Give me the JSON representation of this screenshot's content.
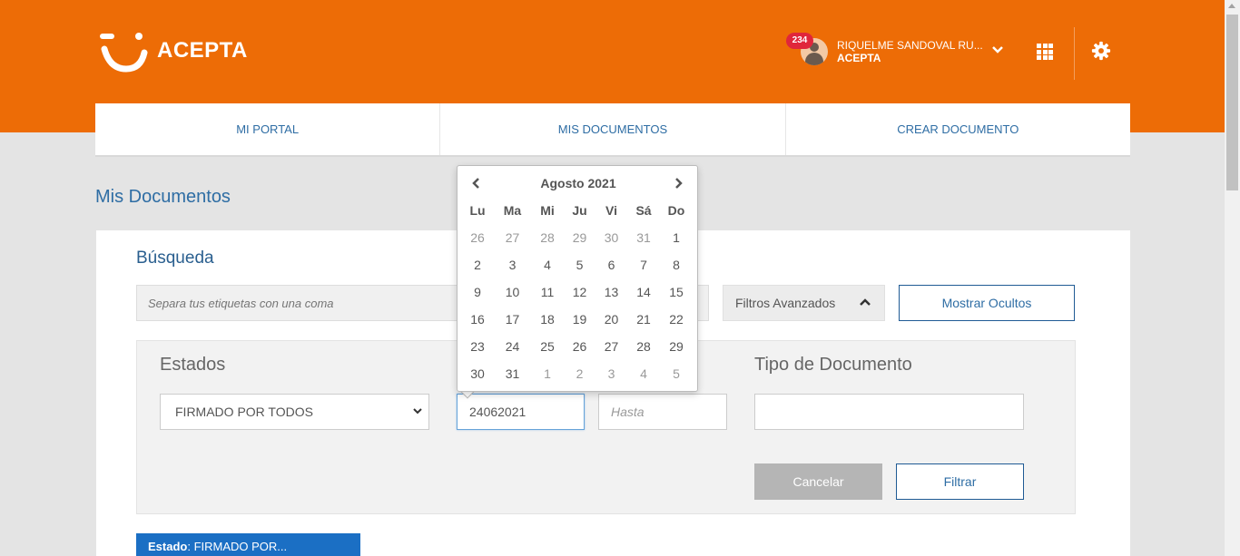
{
  "brand": {
    "name": "ACEPTA",
    "color": "#ed6c06"
  },
  "user": {
    "notifications": "234",
    "name": "RIQUELME SANDOVAL RU...",
    "org": "ACEPTA"
  },
  "nav": {
    "tabs": [
      "MI PORTAL",
      "MIS DOCUMENTOS",
      "CREAR DOCUMENTO"
    ]
  },
  "page": {
    "title": "Mis Documentos"
  },
  "search": {
    "title": "Búsqueda",
    "tags_placeholder": "Separa tus etiquetas con una coma",
    "advanced_filters": "Filtros Avanzados",
    "show_hidden": "Mostrar Ocultos"
  },
  "filters": {
    "estados_label": "Estados",
    "estado_selected": "FIRMADO POR TODOS",
    "date_from_value": "24062021",
    "date_to_placeholder": "Hasta",
    "tipo_label": "Tipo de Documento",
    "cancel": "Cancelar",
    "filter": "Filtrar"
  },
  "chip": {
    "key": "Estado",
    "value": ": FIRMADO POR..."
  },
  "datepicker": {
    "month_label": "Agosto 2021",
    "weekdays": [
      "Lu",
      "Ma",
      "Mi",
      "Ju",
      "Vi",
      "Sá",
      "Do"
    ],
    "weeks": [
      [
        "26",
        "27",
        "28",
        "29",
        "30",
        "31",
        "1"
      ],
      [
        "2",
        "3",
        "4",
        "5",
        "6",
        "7",
        "8"
      ],
      [
        "9",
        "10",
        "11",
        "12",
        "13",
        "14",
        "15"
      ],
      [
        "16",
        "17",
        "18",
        "19",
        "20",
        "21",
        "22"
      ],
      [
        "23",
        "24",
        "25",
        "26",
        "27",
        "28",
        "29"
      ],
      [
        "30",
        "31",
        "1",
        "2",
        "3",
        "4",
        "5"
      ]
    ]
  }
}
